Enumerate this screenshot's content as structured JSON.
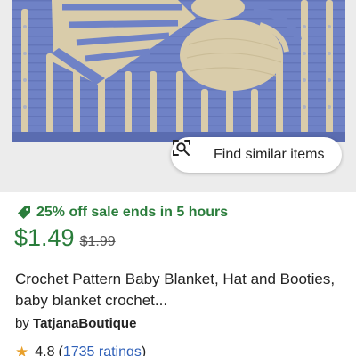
{
  "listing": {
    "image_alt": "Crochet baby blanket with hat and booties",
    "find_similar_label": "Find similar items",
    "sale_text": "25% off sale ends in 5 hours",
    "price": "$1.49",
    "original_price": "$1.99",
    "title": "Crochet Pattern Baby Blanket, Hat and Booties, baby blanket crochet...",
    "seller_prefix": "by",
    "seller_name": "TatjanaBoutique",
    "rating_value": "4.8",
    "rating_count_text": "1735 ratings",
    "paren_open": "(",
    "paren_close": ")"
  },
  "icons": {
    "find_similar": "camera-search-icon",
    "sale": "tag-icon",
    "rating": "star-icon"
  },
  "colors": {
    "sale_green": "#2a7d3b",
    "link_blue": "#2f60b8",
    "star_orange": "#e8a02c",
    "blanket_blue": "#6f82c6",
    "blanket_cream": "#d9ccaa"
  }
}
